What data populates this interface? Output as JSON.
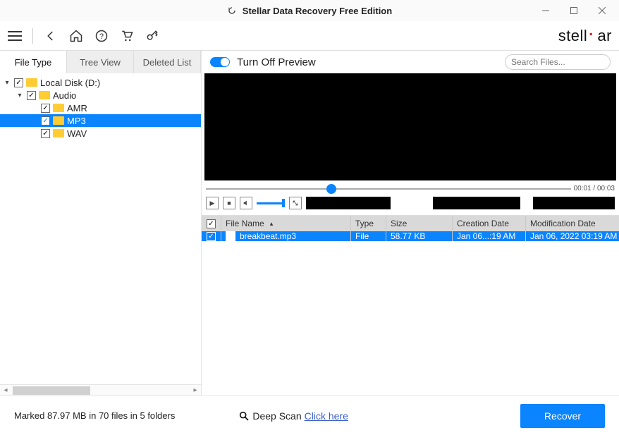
{
  "title": "Stellar Data Recovery Free Edition",
  "brand": "stellar",
  "tabs": {
    "filetype": "File Type",
    "treeview": "Tree View",
    "deleted": "Deleted List"
  },
  "tree": {
    "root": "Local Disk (D:)",
    "audio": "Audio",
    "amr": "AMR",
    "mp3": "MP3",
    "wav": "WAV"
  },
  "preview_toggle": "Turn Off Preview",
  "search_placeholder": "Search Files...",
  "time_current": "00:01",
  "time_total": "00:03",
  "time_sep": " / ",
  "columns": {
    "name": "File Name",
    "type": "Type",
    "size": "Size",
    "cdate": "Creation Date",
    "mdate": "Modification Date"
  },
  "rows": [
    {
      "name": "breakbeat.mp3",
      "type": "File",
      "size": "58.77 KB",
      "cdate": "Jan 06...:19 AM",
      "mdate": "Jan 06, 2022 03:19 AM"
    }
  ],
  "footer": {
    "marked": "Marked 87.97 MB in 70 files in 5 folders",
    "deepscan": "Deep Scan",
    "clickhere": "Click here",
    "recover": "Recover"
  }
}
